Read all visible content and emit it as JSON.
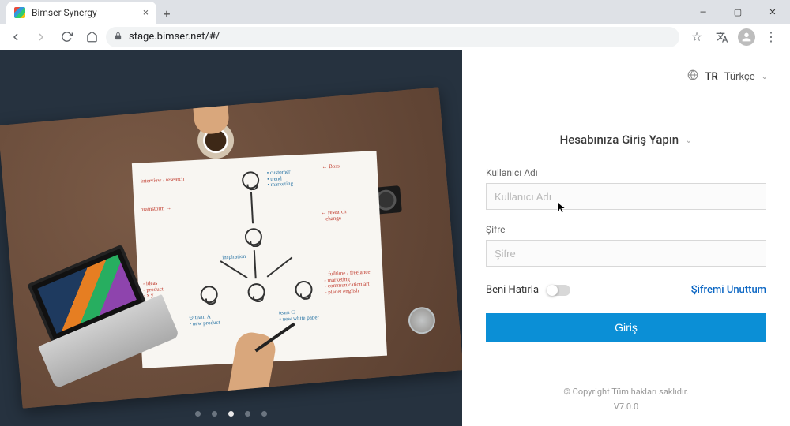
{
  "browser": {
    "tab_title": "Bimser Synergy",
    "url": "stage.bimser.net/#/"
  },
  "language": {
    "code": "TR",
    "name": "Türkçe"
  },
  "login": {
    "title": "Hesabınıza Giriş Yapın",
    "username_label": "Kullanıcı Adı",
    "username_placeholder": "Kullanıcı Adı",
    "password_label": "Şifre",
    "password_placeholder": "Şifre",
    "remember_label": "Beni Hatırla",
    "forgot_label": "Şifremi Unuttum",
    "submit_label": "Giriş"
  },
  "footer": {
    "copyright": "© Copyright Tüm hakları saklıdır.",
    "version": "V7.0.0"
  },
  "carousel": {
    "slide_count": 5,
    "active_index": 2
  }
}
